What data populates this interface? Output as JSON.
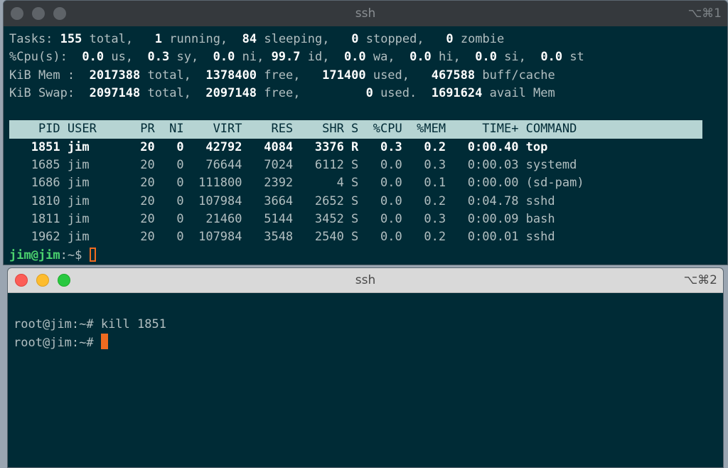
{
  "top_window": {
    "title": "ssh",
    "shortcut": "⌥⌘1",
    "tasks": {
      "label": "Tasks:",
      "total": "155",
      "total_label": "total,",
      "running": "1",
      "running_label": "running,",
      "sleeping": "84",
      "sleeping_label": "sleeping,",
      "stopped": "0",
      "stopped_label": "stopped,",
      "zombie": "0",
      "zombie_label": "zombie"
    },
    "cpu": {
      "label": "%Cpu(s):",
      "us": "0.0",
      "sy": "0.3",
      "ni": "0.0",
      "id": "99.7",
      "wa": "0.0",
      "hi": "0.0",
      "si": "0.0",
      "st": "0.0"
    },
    "mem": {
      "label": "KiB Mem :",
      "total": "2017388",
      "free": "1378400",
      "used": "171400",
      "buff": "467588",
      "buff_label": "buff/cache"
    },
    "swap": {
      "label": "KiB Swap:",
      "total": "2097148",
      "free": "2097148",
      "used": "0",
      "avail": "1691624",
      "avail_label": "avail Mem"
    },
    "columns": [
      "PID",
      "USER",
      "PR",
      "NI",
      "VIRT",
      "RES",
      "SHR",
      "S",
      "%CPU",
      "%MEM",
      "TIME+",
      "COMMAND"
    ],
    "processes": [
      {
        "pid": "1851",
        "user": "jim",
        "pr": "20",
        "ni": "0",
        "virt": "42792",
        "res": "4084",
        "shr": "3376",
        "s": "R",
        "cpu": "0.3",
        "mem": "0.2",
        "time": "0:00.40",
        "cmd": "top"
      },
      {
        "pid": "1685",
        "user": "jim",
        "pr": "20",
        "ni": "0",
        "virt": "76644",
        "res": "7024",
        "shr": "6112",
        "s": "S",
        "cpu": "0.0",
        "mem": "0.3",
        "time": "0:00.03",
        "cmd": "systemd"
      },
      {
        "pid": "1686",
        "user": "jim",
        "pr": "20",
        "ni": "0",
        "virt": "111800",
        "res": "2392",
        "shr": "4",
        "s": "S",
        "cpu": "0.0",
        "mem": "0.1",
        "time": "0:00.00",
        "cmd": "(sd-pam)"
      },
      {
        "pid": "1810",
        "user": "jim",
        "pr": "20",
        "ni": "0",
        "virt": "107984",
        "res": "3664",
        "shr": "2652",
        "s": "S",
        "cpu": "0.0",
        "mem": "0.2",
        "time": "0:04.78",
        "cmd": "sshd"
      },
      {
        "pid": "1811",
        "user": "jim",
        "pr": "20",
        "ni": "0",
        "virt": "21460",
        "res": "5144",
        "shr": "3452",
        "s": "S",
        "cpu": "0.0",
        "mem": "0.3",
        "time": "0:00.09",
        "cmd": "bash"
      },
      {
        "pid": "1962",
        "user": "jim",
        "pr": "20",
        "ni": "0",
        "virt": "107984",
        "res": "3548",
        "shr": "2540",
        "s": "S",
        "cpu": "0.0",
        "mem": "0.2",
        "time": "0:00.01",
        "cmd": "sshd"
      }
    ],
    "prompt_user": "jim@jim",
    "prompt_path": ":~$ "
  },
  "bottom_window": {
    "title": "ssh",
    "shortcut": "⌥⌘2",
    "lines": [
      {
        "prompt": "root@jim:~# ",
        "command": "kill 1851"
      },
      {
        "prompt": "root@jim:~# ",
        "command": ""
      }
    ]
  },
  "colors": {
    "terminal_bg": "#002b36",
    "header_bg": "#b6d4d3",
    "cursor": "#f06b20",
    "prompt_green": "#4bd36e"
  }
}
